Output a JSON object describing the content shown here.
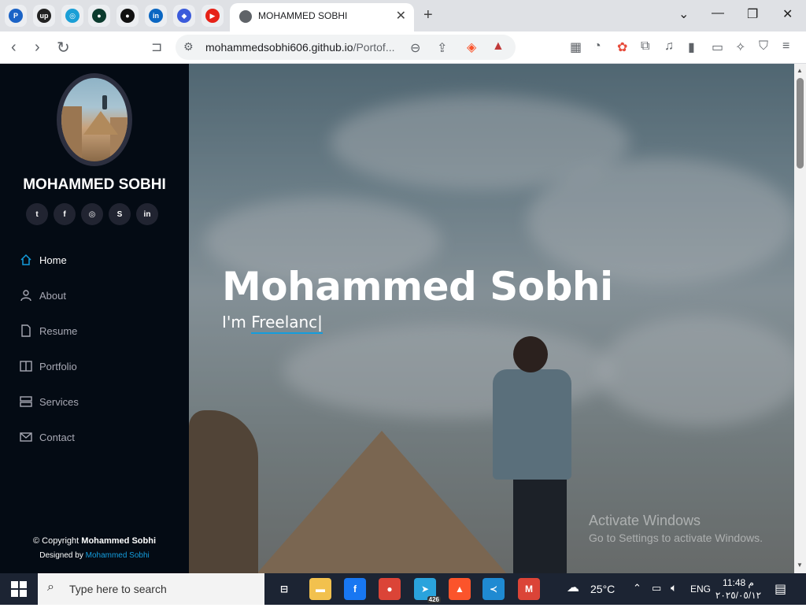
{
  "browser": {
    "pinned_tabs": [
      {
        "icon": "paypal-icon",
        "glyph": "P",
        "color": "#1b63c6"
      },
      {
        "icon": "upwork-icon",
        "glyph": "up",
        "color": "#222"
      },
      {
        "icon": "circle-app-icon",
        "glyph": "◎",
        "color": "#1a9fd6"
      },
      {
        "icon": "dark-app-icon",
        "glyph": "●",
        "color": "#0c3b2e"
      },
      {
        "icon": "github-icon",
        "glyph": "●",
        "color": "#111"
      },
      {
        "icon": "linkedin-icon",
        "glyph": "in",
        "color": "#0a66c2"
      },
      {
        "icon": "diamond-app-icon",
        "glyph": "◆",
        "color": "#3b5bdb"
      },
      {
        "icon": "youtube-icon",
        "glyph": "▶",
        "color": "#e62117"
      }
    ],
    "active_tab_title": "MOHAMMED SOBHI",
    "url_host": "mohammedsobhi606.github.io",
    "url_rest": "/Portof..."
  },
  "sidebar": {
    "name": "MOHAMMED SOBHI",
    "socials": [
      {
        "icon": "twitter-icon",
        "glyph": "t"
      },
      {
        "icon": "facebook-icon",
        "glyph": "f"
      },
      {
        "icon": "instagram-icon",
        "glyph": "◎"
      },
      {
        "icon": "skype-icon",
        "glyph": "S"
      },
      {
        "icon": "linkedin-icon",
        "glyph": "in"
      }
    ],
    "nav": [
      {
        "label": "Home",
        "icon": "home-icon",
        "active": true
      },
      {
        "label": "About",
        "icon": "user-icon",
        "active": false
      },
      {
        "label": "Resume",
        "icon": "file-icon",
        "active": false
      },
      {
        "label": "Portfolio",
        "icon": "book-icon",
        "active": false
      },
      {
        "label": "Services",
        "icon": "server-icon",
        "active": false
      },
      {
        "label": "Contact",
        "icon": "envelope-icon",
        "active": false
      }
    ],
    "footer": {
      "copyright_prefix": "© Copyright",
      "copyright_name": "Mohammed Sobhi",
      "designed_by_prefix": "Designed by",
      "designed_by_name": "Mohammed Sobhi"
    }
  },
  "hero": {
    "title": "Mohammed Sobhi",
    "subtitle_prefix": "I'm",
    "subtitle_typed": "Freelanc|"
  },
  "watermark": {
    "line1": "Activate Windows",
    "line2": "Go to Settings to activate Windows."
  },
  "taskbar": {
    "search_placeholder": "Type here to search",
    "apps": [
      {
        "icon": "task-view-icon",
        "glyph": "⊟",
        "color": "transparent"
      },
      {
        "icon": "file-explorer-icon",
        "glyph": "▬",
        "color": "#f2c14e"
      },
      {
        "icon": "facebook-app-icon",
        "glyph": "f",
        "color": "#1877f2"
      },
      {
        "icon": "chrome-icon",
        "glyph": "●",
        "color": "#db4437"
      },
      {
        "icon": "telegram-icon",
        "glyph": "➤",
        "color": "#2aa3dc",
        "badge": "426"
      },
      {
        "icon": "brave-icon",
        "glyph": "▲",
        "color": "#fb542b"
      },
      {
        "icon": "vscode-icon",
        "glyph": "≺",
        "color": "#1f8ad2"
      },
      {
        "icon": "chrome-profile-icon",
        "glyph": "M",
        "color": "#db4437"
      }
    ],
    "weather_temp": "25°C",
    "language": "ENG",
    "time": "11:48 م",
    "date": "٢٠٢٥/٠٥/١٢"
  }
}
